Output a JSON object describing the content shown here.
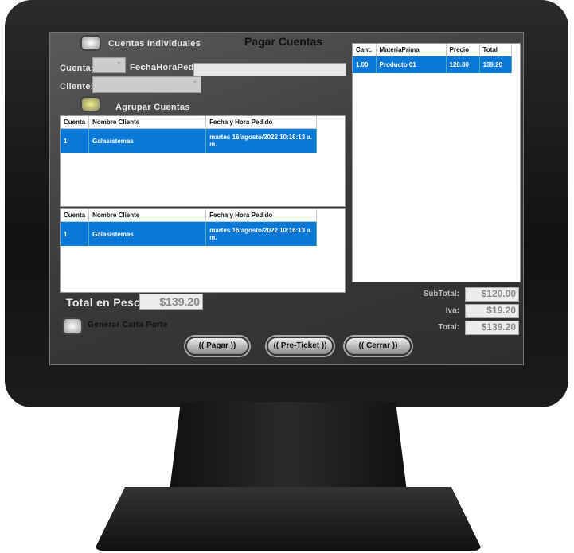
{
  "window": {
    "title": "Pagar Cuentas"
  },
  "options": {
    "individual": "Cuentas Individuales",
    "agrupar": "Agrupar Cuentas",
    "carta_porte": "Generar Carta Porte"
  },
  "form": {
    "cuenta_label": "Cuenta:",
    "fecha_label": "FechaHoraPedido:",
    "cliente_label": "Cliente:",
    "cuenta_value": "",
    "fecha_value": "",
    "cliente_value": ""
  },
  "grid1": {
    "headers": [
      "Cuenta",
      "Nombre Cliente",
      "Fecha y Hora Pedido"
    ],
    "rows": [
      [
        "1",
        "Galasistemas",
        "martes 16/agosto/2022 10:16:13 a. m."
      ]
    ]
  },
  "grid2": {
    "headers": [
      "Cuenta",
      "Nombre Cliente",
      "Fecha y Hora Pedido"
    ],
    "rows": [
      [
        "1",
        "Galasistemas",
        "martes 16/agosto/2022 10:16:13 a. m."
      ]
    ]
  },
  "items": {
    "headers": [
      "Cant.",
      "MateriaPrima",
      "Precio",
      "Total"
    ],
    "rows": [
      [
        "1.00",
        "Producto 01",
        "120.00",
        "139.20"
      ]
    ]
  },
  "totals": {
    "pesos_label": "Total en Pesos:",
    "pesos": "$139.20",
    "subtotal_label": "SubTotal:",
    "subtotal": "$120.00",
    "iva_label": "Iva:",
    "iva": "$19.20",
    "total_label": "Total:",
    "total": "$139.20"
  },
  "buttons": {
    "pagar": "(( Pagar ))",
    "preticket": "(( Pre-Ticket ))",
    "cerrar": "(( Cerrar ))"
  }
}
